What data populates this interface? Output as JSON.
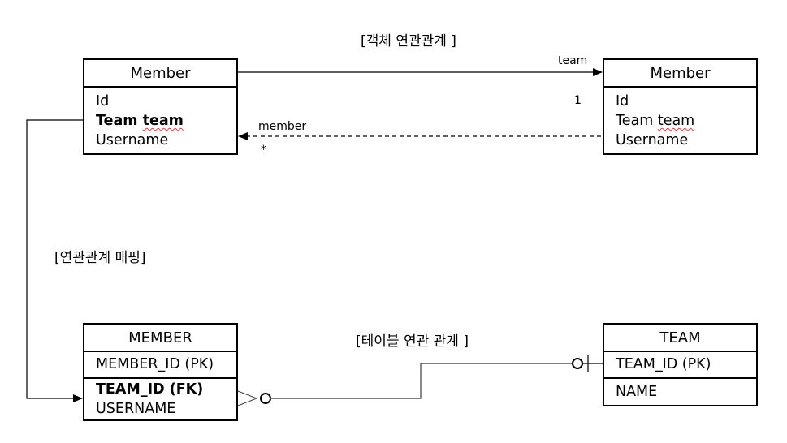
{
  "captions": {
    "object_relation": "[객체 연관관계 ]",
    "mapping": "[연관관계 매핑]",
    "table_relation": "[테이블 연관 관계 ]"
  },
  "object_model": {
    "left_class": {
      "name": "Member",
      "fields": [
        {
          "text_a": "Id",
          "text_b": "",
          "bold": false
        },
        {
          "text_a": "Team ",
          "text_b": "team",
          "bold": true
        },
        {
          "text_a": "Username",
          "text_b": "",
          "bold": false
        }
      ]
    },
    "right_class": {
      "name": "Member",
      "fields": [
        {
          "text_a": "Id",
          "text_b": "",
          "bold": false
        },
        {
          "text_a": "Team ",
          "text_b": "team",
          "bold": false
        },
        {
          "text_a": "Username",
          "text_b": "",
          "bold": false
        }
      ]
    },
    "association_team": {
      "role": "team",
      "multiplicity": "1",
      "style": "solid"
    },
    "association_member": {
      "role": "member",
      "multiplicity": "*",
      "style": "dashed"
    }
  },
  "table_model": {
    "member_table": {
      "name": "MEMBER",
      "pk": "MEMBER_ID (PK)",
      "fk": "TEAM_ID (FK)",
      "columns": [
        "USERNAME"
      ]
    },
    "team_table": {
      "name": "TEAM",
      "pk": "TEAM_ID (PK)",
      "columns": [
        "NAME"
      ]
    },
    "relationship": {
      "member_end": "zero-or-many",
      "team_end": "zero-or-one"
    }
  },
  "colors": {
    "line": "#000000",
    "connector_gray": "#555555",
    "spellcheck_underline": "#d94040"
  }
}
